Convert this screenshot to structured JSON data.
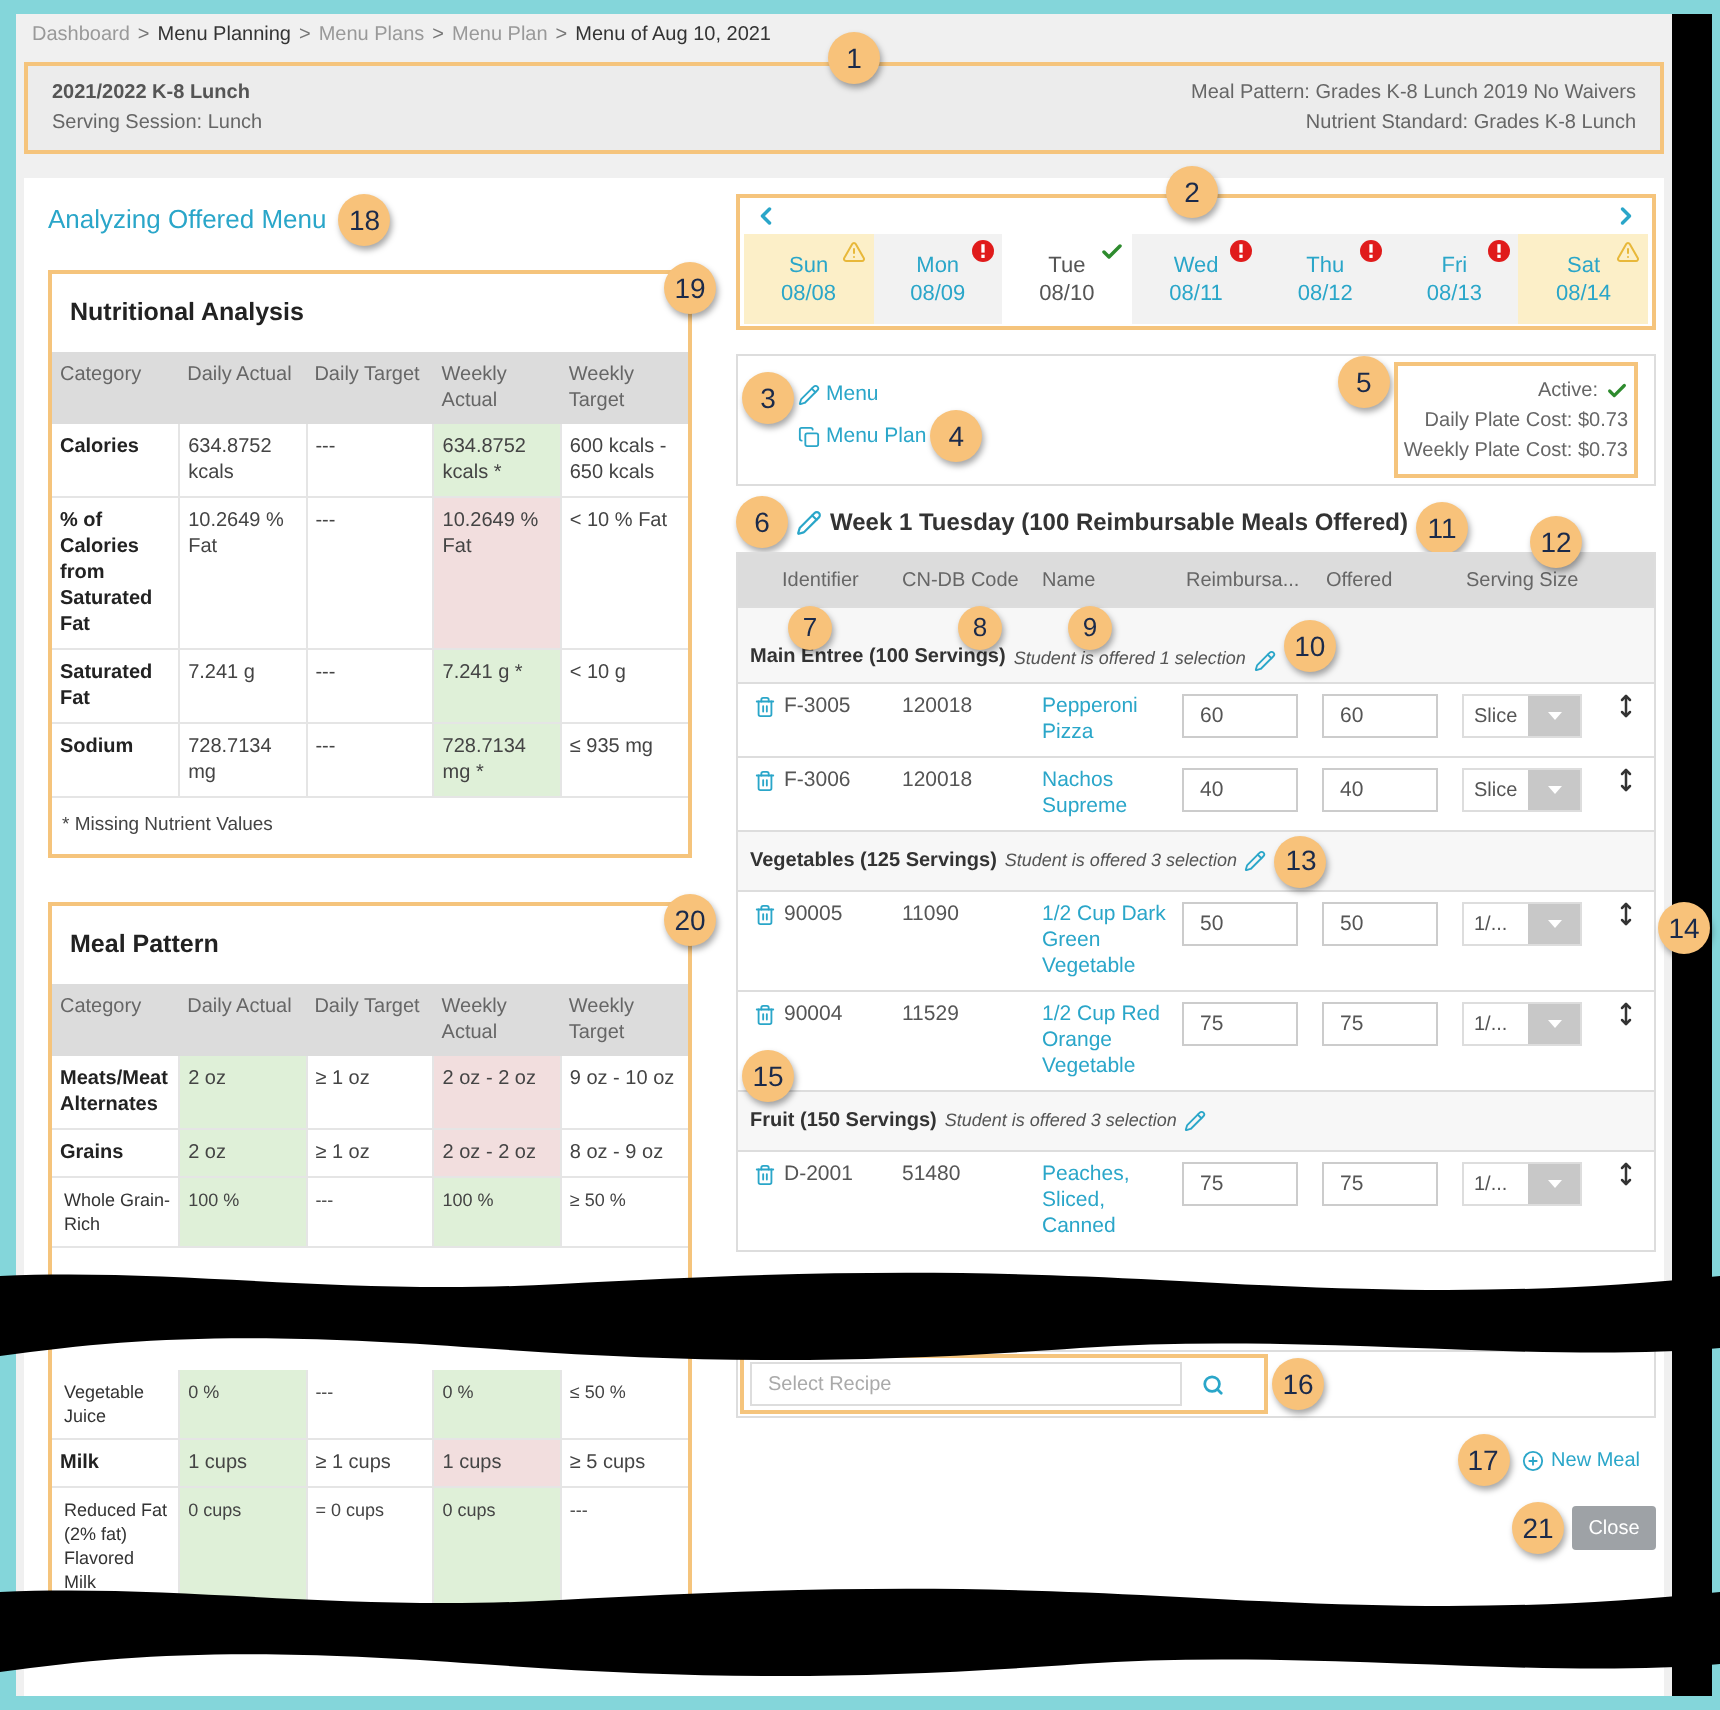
{
  "breadcrumb": [
    {
      "label": "Dashboard",
      "emphasis": false
    },
    {
      "separator": ">",
      "label": "Menu Planning",
      "emphasis": true
    },
    {
      "separator": ">",
      "label": "Menu Plans",
      "emphasis": false
    },
    {
      "separator": ">",
      "label": "Menu Plan",
      "emphasis": false
    },
    {
      "separator": ">",
      "label": "Menu of Aug 10, 2021",
      "emphasis": true
    }
  ],
  "header": {
    "title": "2021/2022 K-8 Lunch",
    "serving_session": "Serving Session: Lunch",
    "meal_pattern": "Meal Pattern: Grades K-8 Lunch 2019 No Waivers",
    "nutrient_standard": "Nutrient Standard: Grades K-8 Lunch"
  },
  "analysis_title": "Analyzing Offered Menu",
  "nutritional_analysis": {
    "title": "Nutritional Analysis",
    "columns": [
      "Category",
      "Daily Actual",
      "Daily Target",
      "Weekly Actual",
      "Weekly Target"
    ],
    "rows": [
      {
        "kind": "main",
        "cells": [
          {
            "text": "Calories"
          },
          {
            "text": "634.8752 kcals"
          },
          {
            "text": "---"
          },
          {
            "text": "634.8752 kcals *",
            "pass": true
          },
          {
            "text": "600 kcals - 650 kcals"
          }
        ]
      },
      {
        "kind": "main",
        "cells": [
          {
            "text": "% of Calories from Saturated Fat"
          },
          {
            "text": "10.2649 % Fat"
          },
          {
            "text": "---"
          },
          {
            "text": "10.2649 % Fat",
            "pass": false
          },
          {
            "text": "< 10 % Fat"
          }
        ]
      },
      {
        "kind": "main",
        "cells": [
          {
            "text": "Saturated Fat"
          },
          {
            "text": "7.241 g"
          },
          {
            "text": "---"
          },
          {
            "text": "7.241 g *",
            "pass": true
          },
          {
            "text": "< 10 g"
          }
        ]
      },
      {
        "kind": "main",
        "cells": [
          {
            "text": "Sodium"
          },
          {
            "text": "728.7134 mg"
          },
          {
            "text": "---"
          },
          {
            "text": "728.7134 mg *",
            "pass": true
          },
          {
            "text": "≤ 935 mg"
          }
        ]
      }
    ],
    "footnote": "* Missing Nutrient Values"
  },
  "meal_pattern": {
    "title": "Meal Pattern",
    "columns": [
      "Category",
      "Daily Actual",
      "Daily Target",
      "Weekly Actual",
      "Weekly Target"
    ],
    "rows": [
      {
        "kind": "main",
        "cells": [
          {
            "text": "Meats/Meat Alternates"
          },
          {
            "text": "2 oz",
            "pass": true
          },
          {
            "text": "≥ 1 oz"
          },
          {
            "text": "2 oz - 2 oz",
            "pass": false
          },
          {
            "text": "9 oz - 10 oz"
          }
        ]
      },
      {
        "kind": "main",
        "cells": [
          {
            "text": "Grains"
          },
          {
            "text": "2 oz",
            "pass": true
          },
          {
            "text": "≥ 1 oz"
          },
          {
            "text": "2 oz - 2 oz",
            "pass": false
          },
          {
            "text": "8 oz - 9 oz"
          }
        ]
      },
      {
        "kind": "sub",
        "cells": [
          {
            "text": "Whole Grain-Rich"
          },
          {
            "text": "100 %",
            "pass": true
          },
          {
            "text": "---"
          },
          {
            "text": "100 %",
            "pass": true
          },
          {
            "text": "≥ 50 %"
          }
        ]
      },
      {
        "kind": "sub",
        "cells": [
          {
            "text": "Vegetable Juice"
          },
          {
            "text": "0 %",
            "pass": true
          },
          {
            "text": "---"
          },
          {
            "text": "0 %",
            "pass": true
          },
          {
            "text": "≤ 50 %"
          }
        ]
      },
      {
        "kind": "main",
        "cells": [
          {
            "text": "Milk"
          },
          {
            "text": "1 cups",
            "pass": true
          },
          {
            "text": "≥ 1 cups"
          },
          {
            "text": "1 cups",
            "pass": false
          },
          {
            "text": "≥ 5 cups"
          }
        ]
      },
      {
        "kind": "sub",
        "cells": [
          {
            "text": "Reduced Fat (2% fat) Flavored Milk"
          },
          {
            "text": "0 cups",
            "pass": true
          },
          {
            "text": "= 0 cups"
          },
          {
            "text": "0 cups",
            "pass": true
          },
          {
            "text": "---"
          }
        ]
      }
    ]
  },
  "calendar": {
    "days": [
      {
        "day": "Sun",
        "date": "08/08",
        "weekend": true,
        "selected": false,
        "warning": true,
        "error": false,
        "complete": false
      },
      {
        "day": "Mon",
        "date": "08/09",
        "weekend": false,
        "selected": false,
        "warning": false,
        "error": true,
        "complete": false
      },
      {
        "day": "Tue",
        "date": "08/10",
        "weekend": false,
        "selected": true,
        "warning": false,
        "error": false,
        "complete": true
      },
      {
        "day": "Wed",
        "date": "08/11",
        "weekend": false,
        "selected": false,
        "warning": false,
        "error": true,
        "complete": false
      },
      {
        "day": "Thu",
        "date": "08/12",
        "weekend": false,
        "selected": false,
        "warning": false,
        "error": true,
        "complete": false
      },
      {
        "day": "Fri",
        "date": "08/13",
        "weekend": false,
        "selected": false,
        "warning": false,
        "error": true,
        "complete": false
      },
      {
        "day": "Sat",
        "date": "08/14",
        "weekend": true,
        "selected": false,
        "warning": true,
        "error": false,
        "complete": false
      }
    ]
  },
  "menu_info": {
    "links": [
      {
        "kind": "edit",
        "label": "Menu"
      },
      {
        "kind": "copy",
        "label": "Menu Plan"
      }
    ],
    "active_label": "Active:",
    "active": true,
    "daily_plate_cost": "Daily Plate Cost: $0.73",
    "weekly_plate_cost": "Weekly Plate Cost: $0.73"
  },
  "week_title": "Week 1 Tuesday (100 Reimbursable Meals Offered)",
  "table": {
    "columns": [
      "Identifier",
      "CN-DB Code",
      "Name",
      "Reimbursa...",
      "Offered",
      "Serving Size"
    ],
    "groups": [
      {
        "title": "Main Entree (100 Servings)",
        "note": "Student is offered 1 selection",
        "items": [
          {
            "identifier": "F-3005",
            "code": "120018",
            "name": "Pepperoni Pizza",
            "reimbursable": "60",
            "offered": "60",
            "serving": "Slice"
          },
          {
            "identifier": "F-3006",
            "code": "120018",
            "name": "Nachos Supreme",
            "reimbursable": "40",
            "offered": "40",
            "serving": "Slice"
          }
        ]
      },
      {
        "title": "Vegetables (125 Servings)",
        "note": "Student is offered 3 selection",
        "items": [
          {
            "identifier": "90005",
            "code": "11090",
            "name": "1/2 Cup Dark Green Vegetable",
            "reimbursable": "50",
            "offered": "50",
            "serving": "1/..."
          },
          {
            "identifier": "90004",
            "code": "11529",
            "name": "1/2 Cup Red Orange Vegetable",
            "reimbursable": "75",
            "offered": "75",
            "serving": "1/..."
          }
        ]
      },
      {
        "title": "Fruit (150 Servings)",
        "note": "Student is offered 3 selection",
        "items": [
          {
            "identifier": "D-2001",
            "code": "51480",
            "name": "Peaches, Sliced, Canned",
            "reimbursable": "75",
            "offered": "75",
            "serving": "1/..."
          }
        ]
      }
    ]
  },
  "recipe_search": {
    "placeholder": "Select Recipe"
  },
  "new_meal": "New Meal",
  "close": "Close",
  "callouts": [
    "1",
    "2",
    "3",
    "4",
    "5",
    "6",
    "7",
    "8",
    "9",
    "10",
    "11",
    "12",
    "13",
    "14",
    "15",
    "16",
    "17",
    "18",
    "19",
    "20",
    "21"
  ]
}
